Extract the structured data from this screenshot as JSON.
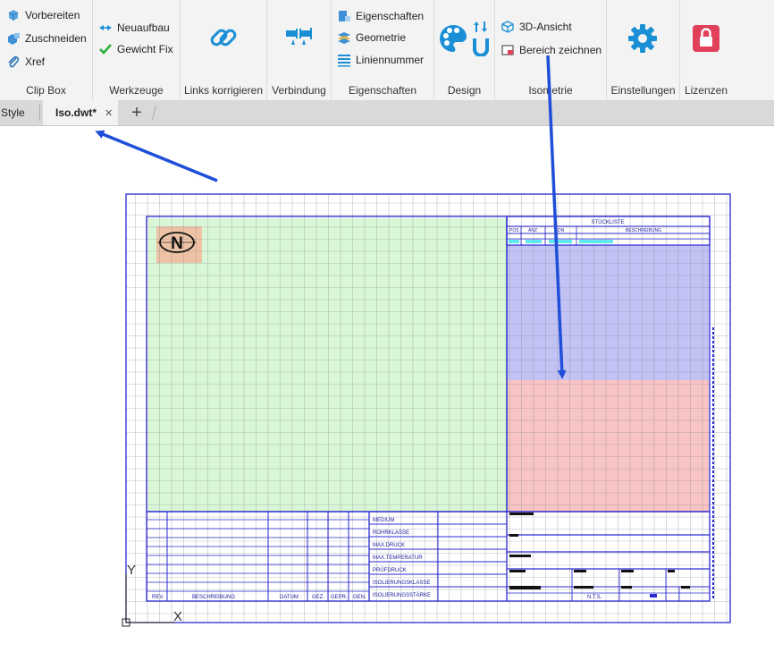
{
  "ribbon": {
    "clipbox": {
      "label": "Clip Box",
      "buttons": [
        "Vorbereiten",
        "Zuschneiden",
        "Xref"
      ]
    },
    "werkzeuge": {
      "label": "Werkzeuge",
      "buttons": [
        "Neuaufbau",
        "Gewicht Fix"
      ]
    },
    "links": {
      "label": "Links korrigieren"
    },
    "verbindung": {
      "label": "Verbindung"
    },
    "eigenschaften": {
      "label": "Eigenschaften",
      "buttons": [
        "Eigenschaften",
        "Geometrie",
        "Liniennummer"
      ]
    },
    "design": {
      "label": "Design"
    },
    "isometrie": {
      "label": "Isometrie",
      "buttons": [
        "3D-Ansicht",
        "Bereich zeichnen"
      ]
    },
    "einstellungen": {
      "label": "Einstellungen"
    },
    "lizenzen": {
      "label": "Lizenzen"
    }
  },
  "tabs": {
    "left_tab": "Style",
    "active_tab": "Iso.dwt*",
    "close_glyph": "✕",
    "add_glyph": "+"
  },
  "drawing": {
    "north_symbol": "N",
    "parts_list_title": "STÜCKLISTE",
    "parts_list_columns": [
      "POS",
      "ANZ",
      "DN",
      "BESCHREIBUNG"
    ],
    "title_block_fields": [
      "MEDIUM",
      "ROHRKLASSE",
      "MAX.DRUCK",
      "MAX.TEMPERATUR",
      "PRÜFDRUCK",
      "ISOLIERUNGSKLASSE",
      "ISOLIERUNGSSTÄRKE"
    ],
    "revision_columns": [
      "REV.",
      "BESCHREIBUNG",
      "DATUM",
      "GEZ.",
      "GEPR.",
      "GEN."
    ],
    "scale_text": "N.T.S.",
    "axis_x": "X",
    "axis_y": "Y"
  },
  "colors": {
    "accent_blue": "#1a8fd6",
    "annotation_arrow": "#1f4fd8",
    "drawing_line": "#2a2ad0",
    "zone_green": "#d9f7d6",
    "zone_blue": "#c2c2f5",
    "zone_red": "#f8c4c4",
    "north_box": "#eec2a4",
    "license_red": "#e0405a"
  }
}
